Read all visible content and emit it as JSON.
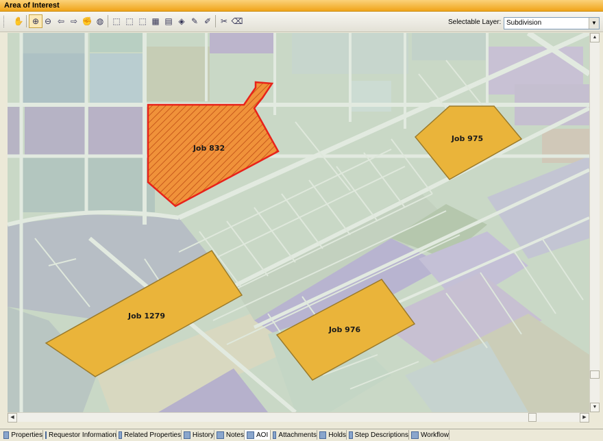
{
  "window": {
    "title": "Area of Interest"
  },
  "toolbar": {
    "buttons": [
      "pan-identify-icon",
      "zoom-in-icon",
      "zoom-out-icon",
      "back-icon",
      "forward-icon",
      "pan-hand-icon",
      "full-extent-icon",
      "select-icon",
      "select-add-icon",
      "select-info-icon",
      "clear-selection-icon",
      "report-icon",
      "layer-icon",
      "edit-icon",
      "sketch-icon",
      "tools-icon",
      "erase-icon"
    ],
    "selectable_layer_label": "Selectable Layer:",
    "selectable_layer_value": "Subdivision"
  },
  "map": {
    "jobs": [
      {
        "label": "Job 832",
        "selected": true
      },
      {
        "label": "Job 975",
        "selected": false
      },
      {
        "label": "Job 1279",
        "selected": false
      },
      {
        "label": "Job 976",
        "selected": false
      }
    ],
    "colors": {
      "job_fill": "#eab43a",
      "selected_outline": "#e8221a",
      "selected_fill": "#f0923a"
    }
  },
  "tabs": [
    {
      "label": "Properties"
    },
    {
      "label": "Requestor Information"
    },
    {
      "label": "Related Properties"
    },
    {
      "label": "History"
    },
    {
      "label": "Notes"
    },
    {
      "label": "AOI",
      "active": true
    },
    {
      "label": "Attachments"
    },
    {
      "label": "Holds"
    },
    {
      "label": "Step Descriptions"
    },
    {
      "label": "Workflow"
    }
  ]
}
